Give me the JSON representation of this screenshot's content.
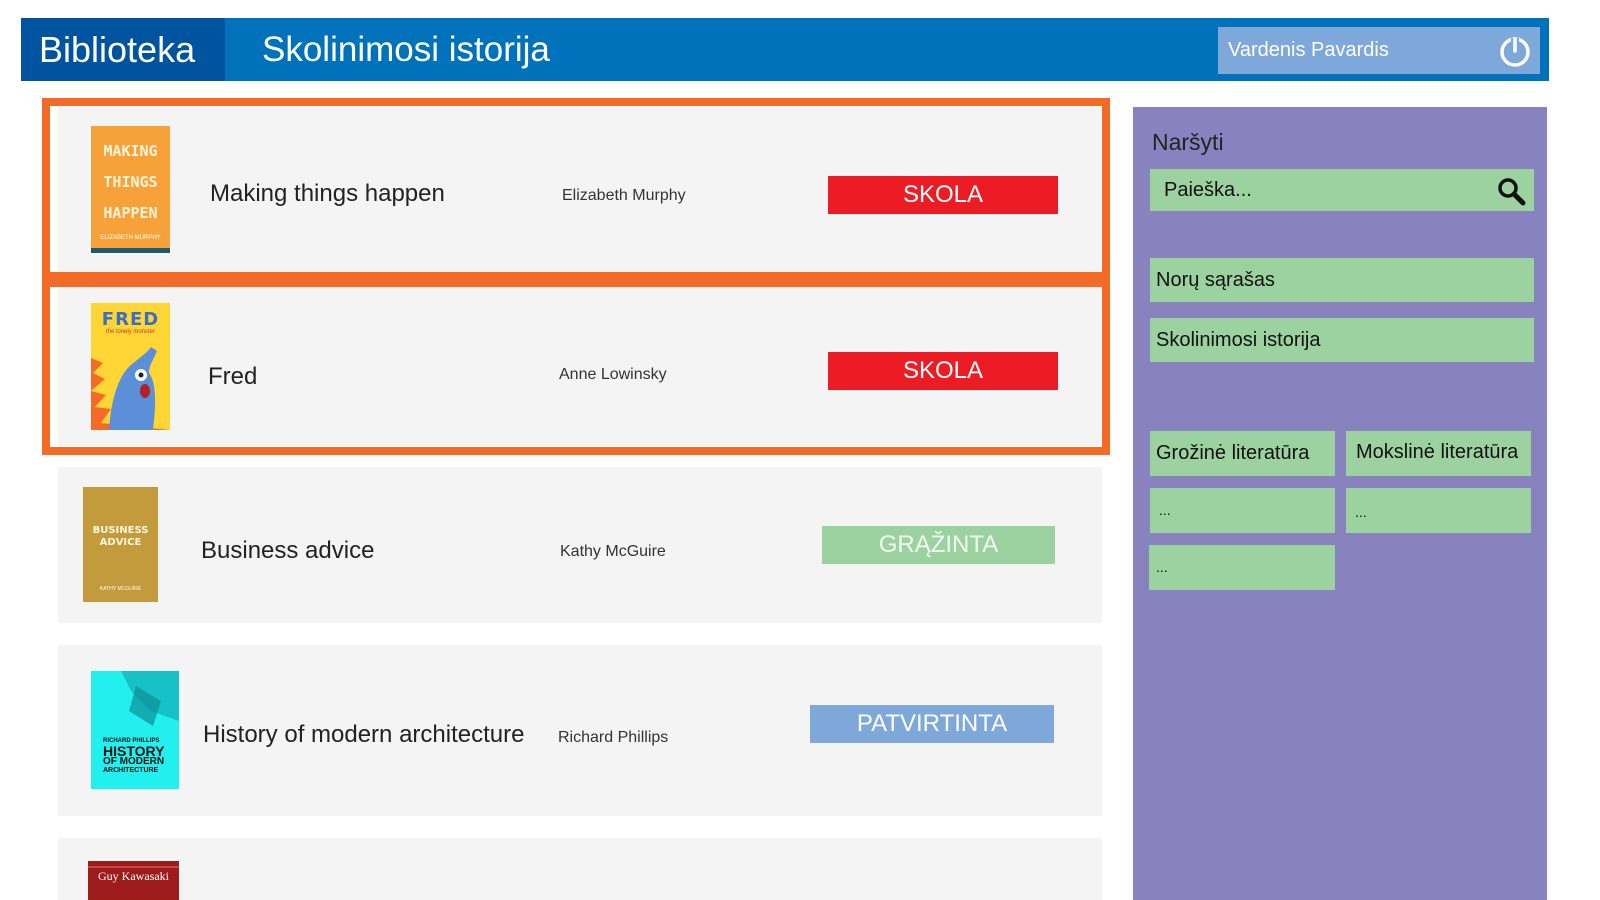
{
  "header": {
    "brand": "Biblioteka",
    "title": "Skolinimosi istorija",
    "user": "Vardenis Pavardis",
    "logout_icon": "power-icon"
  },
  "colors": {
    "header": "#0072bc",
    "brand": "#00539f",
    "highlight": "#f36b26",
    "sidebar": "#8882be",
    "green": "#9cd2a0",
    "debt": "#ed1c24",
    "confirmed": "#7fa8da"
  },
  "items": [
    {
      "title": "Making things happen",
      "author": "Elizabeth Murphy",
      "status": "SKOLA",
      "cover": {
        "l1": "MAKING",
        "l2": "THINGS",
        "l3": "HAPPEN",
        "by": "ELIZABETH MURPHY"
      }
    },
    {
      "title": "Fred",
      "author": "Anne Lowinsky",
      "status": "SKOLA",
      "cover": {
        "l1": "FRED",
        "l2": "the lonely monster"
      }
    },
    {
      "title": "Business advice",
      "author": "Kathy McGuire",
      "status": "GRĄŽINTA",
      "cover": {
        "l1": "BUSINESS",
        "l2": "ADVICE",
        "by": "KATHY MCGUIRE"
      }
    },
    {
      "title": "History of modern architecture",
      "author": "Richard Phillips",
      "status": "PATVIRTINTA",
      "cover": {
        "l0": "RICHARD PHILLIPS",
        "l1": "HISTORY",
        "l2": "OF MODERN",
        "l3": "ARCHITECTURE"
      }
    },
    {
      "cover": {
        "l1": "Guy Kawasaki"
      }
    }
  ],
  "sidebar": {
    "browse": "Naršyti",
    "search_placeholder": "Paieška...",
    "links": [
      "Norų sąrašas",
      "Skolinimosi istorija"
    ],
    "categories": [
      "Grožinė literatūra",
      "Mokslinė literatūra",
      "...",
      "...",
      "..."
    ]
  }
}
